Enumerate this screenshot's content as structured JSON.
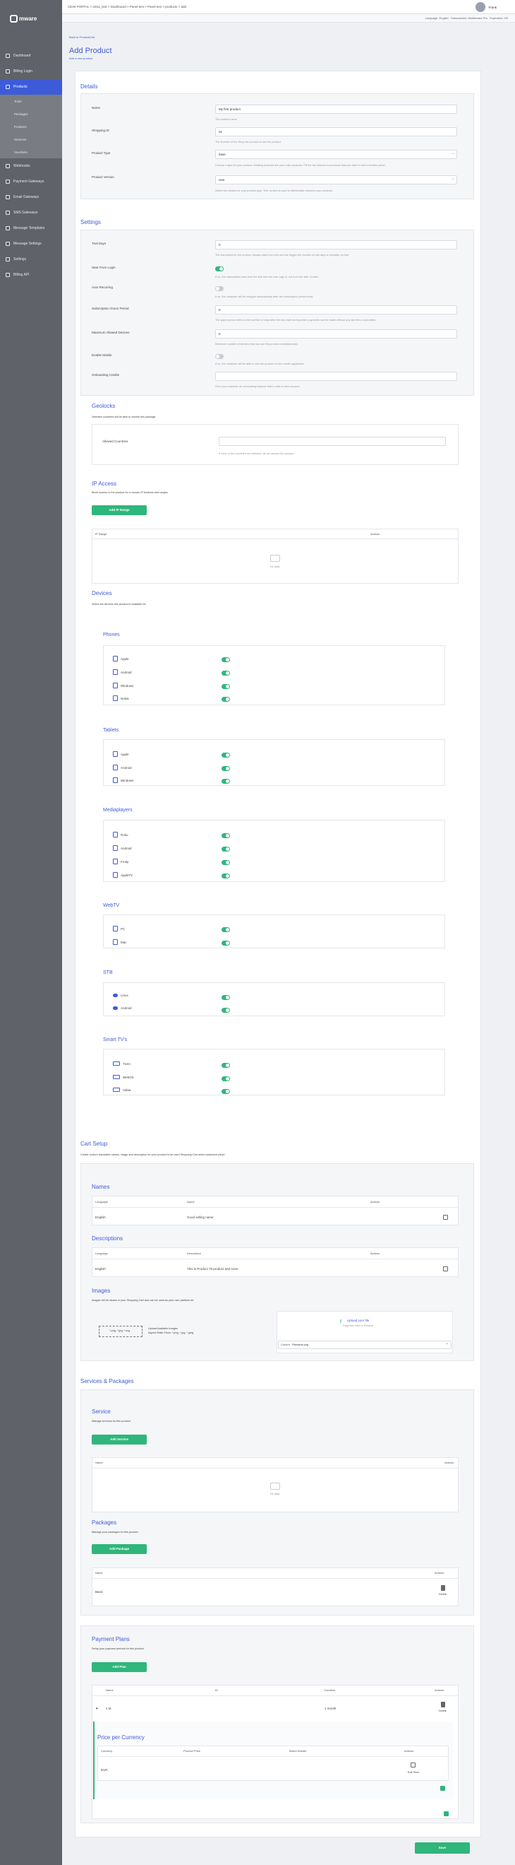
{
  "brand": "mware",
  "topbar": {
    "breadcrumb": "Client PORTAL > clima_test > Dashboard > Panel test > Panel test > products > add",
    "user": "Frank"
  },
  "subbar": {
    "language": "Language: English",
    "subscription": "Subscription: Middleware Pro",
    "expiration": "Expiration: 0/0"
  },
  "sidebar": {
    "items": [
      {
        "label": "Dashboard"
      },
      {
        "label": "Billing Login"
      },
      {
        "label": "Products"
      },
      {
        "label": "Webhooks"
      },
      {
        "label": "Payment Gateways"
      },
      {
        "label": "Email Gateways"
      },
      {
        "label": "SMS Gateways"
      },
      {
        "label": "Message Templates"
      },
      {
        "label": "Message Settings"
      },
      {
        "label": "Settings"
      },
      {
        "label": "Billing API"
      }
    ],
    "subitems": [
      {
        "label": "Tools"
      },
      {
        "label": "Packages"
      },
      {
        "label": "Products"
      },
      {
        "label": "Services"
      },
      {
        "label": "Vouchers"
      }
    ]
  },
  "page": {
    "back": "Back to Products list",
    "title": "Add Product",
    "subtitle": "Add a new product"
  },
  "details": {
    "title": "Details",
    "name_label": "Name",
    "name_value": "My first product",
    "name_help": "The product name",
    "shopping_label": "Shopping ID",
    "shopping_value": "01",
    "shopping_help": "The Number of the Shop the product to use the product",
    "type_label": "Product Type",
    "type_value": "base",
    "type_help": "Choose a type for your product. Building products are your main products. Fill the bar addons for products that you want to sell in another panel.",
    "version_label": "Product Version",
    "version_value": "new",
    "version_help": "Select the version for your product type. This version is used to differentiate between your products."
  },
  "settings": {
    "title": "Settings",
    "trial_label": "Trial Days",
    "trial_value": "0",
    "trial_help": "The trial period for the product. Always start from zero and the trigger the number of trial days is normally, no trial.",
    "first_login_label": "Start From Login",
    "first_login_help": "If on, the subscription start from the first time the user logs in, not from the date of order.",
    "auto_label": "Auto Recurring",
    "auto_help": "If on, the customer will be charged automatically after the subscription period ends.",
    "grace_label": "Subscription Grace Period",
    "grace_value": "0",
    "grace_help": "The grace period refers to the number of days after the due date during which payments can be made without any late fees or penalties.",
    "devices_label": "Maximum Allowed Devices",
    "devices_value": "0",
    "devices_help": "Maximum number of devices that can use this product simultaneously.",
    "enable_label": "Enable Mobile",
    "enable_help": "If on, the customer will be able to see the product on the mobile application.",
    "credits_label": "Onboarding Credits",
    "credits_value": "",
    "credits_help": "Give your customer an onboarding balance that is valid in their account."
  },
  "geolocks": {
    "title": "Geolocks",
    "desc": "Selected countries will be able to access this package",
    "label": "Allowed Countries",
    "help": "If none of the countries are selected, all can access the product."
  },
  "ip_access": {
    "title": "IP Access",
    "desc": "Block access to the product for a chosen IP Address and ranges",
    "button": "Add IP Range",
    "col_ip": "IP Range",
    "col_actions": "Actions",
    "empty": "No data"
  },
  "devices": {
    "title": "Devices",
    "desc": "Select the devices this product is available for",
    "groups": [
      {
        "title": "Phones",
        "items": [
          "Apple",
          "Android",
          "Windows",
          "Nokia"
        ]
      },
      {
        "title": "Tablets",
        "items": [
          "Apple",
          "Android",
          "Windows"
        ]
      },
      {
        "title": "Mediaplayers",
        "items": [
          "Roku",
          "Android",
          "Fruity",
          "AppleTV"
        ]
      },
      {
        "title": "WebTV",
        "items": [
          "PC",
          "Mac"
        ]
      },
      {
        "title": "STB",
        "items": [
          "Linux",
          "Android"
        ]
      },
      {
        "title": "Smart TV's",
        "items": [
          "Tizen",
          "WebOS",
          "Vidaa"
        ]
      }
    ]
  },
  "cart": {
    "title": "Cart Setup",
    "desc": "Create custom translated names, image and description for your product to be used Shopping Cart when customize panel",
    "names_title": "Names",
    "names_cols": [
      "Language",
      "Name",
      "Actions"
    ],
    "names_row": [
      "English",
      "Good selling name"
    ],
    "desc_title": "Descriptions",
    "desc_cols": [
      "Language",
      "Description",
      "Actions"
    ],
    "desc_row": [
      "English",
      "This is Product 79 product and more"
    ],
    "images_title": "Images",
    "images_desc": "Images will be shown in your Shopping Cart and can be used as your own platform ter",
    "img_types": "*.png, *.jpg, *.svg",
    "img_hint": "Upload Available Images",
    "img_ratio": "Aspect Ratio Fixes: *.png, *.jpg, *.jpeg",
    "upload_title": "Upload your file",
    "upload_hint": "Drag files here or Browse",
    "file_label": "Current",
    "file_name": "Filename.png"
  },
  "services_packages": {
    "title": "Services & Packages",
    "service_title": "Service",
    "service_desc": "Manage services for this product",
    "service_button": "Add Service",
    "service_cols": [
      "Name",
      "Actions"
    ],
    "service_empty": "No data",
    "package_title": "Packages",
    "package_desc": "Manage your packages for this product",
    "package_button": "Add Package",
    "package_cols": [
      "Name",
      "Actions"
    ],
    "package_row": "Basic",
    "delete": "Delete"
  },
  "payment": {
    "title": "Payment Plans",
    "desc": "Setup your payment periods for this product",
    "button": "Add Plan",
    "cols": [
      "Name",
      "ID",
      "Duration",
      "Actions"
    ],
    "row": [
      "1 M",
      "",
      "1 month"
    ],
    "delete": "Delete",
    "price_title": "Price per Currency",
    "price_cols": [
      "Currency",
      "Product Price",
      "Match Bundle",
      "Actions"
    ],
    "price_row": [
      "EUR",
      "",
      ""
    ],
    "edit": "Edit Price"
  },
  "save": "Save"
}
